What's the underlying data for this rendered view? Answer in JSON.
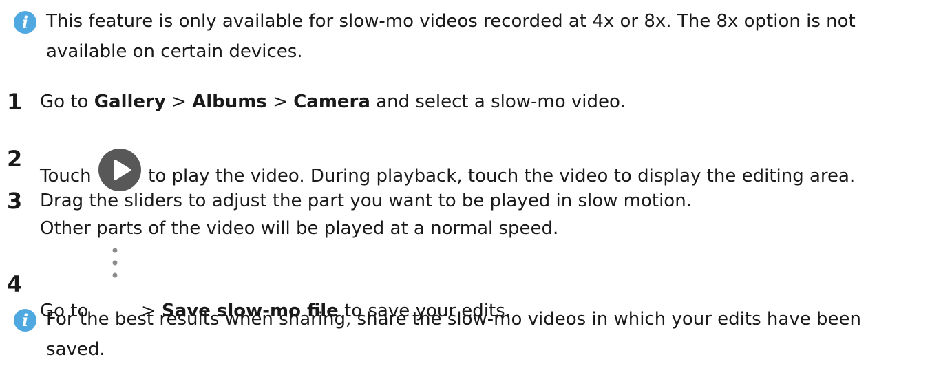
{
  "note_top": {
    "icon": "info-icon",
    "icon_letter": "i",
    "text": "This feature is only available for slow-mo videos recorded at 4x or 8x. The 8x option is not available on certain devices."
  },
  "steps": [
    {
      "number": "1",
      "text_a": "Go to ",
      "gallery": "Gallery",
      "sep1": " > ",
      "albums": "Albums",
      "sep2": " > ",
      "camera": "Camera",
      "text_b": " and select a slow-mo video."
    },
    {
      "number": "2",
      "text_a": "Touch ",
      "icon": "play-icon",
      "text_b": " to play the video. During playback, touch the video to display the editing area."
    },
    {
      "number": "3",
      "line1": "Drag the sliders to adjust the part you want to be played in slow motion.",
      "line2": "Other parts of the video will be played at a normal speed."
    },
    {
      "number": "4",
      "text_a": "Go to ",
      "icon": "more-vertical-icon",
      "sep": " > ",
      "save": "Save slow-mo file",
      "text_b": " to save your edits."
    }
  ],
  "note_bottom": {
    "icon": "info-icon",
    "icon_letter": "i",
    "text": "For the best results when sharing, share the slow-mo videos in which your edits have been saved."
  },
  "colors": {
    "info_icon": "#4fa8e0",
    "play_icon": "#585858",
    "text": "#1a1a1a"
  }
}
